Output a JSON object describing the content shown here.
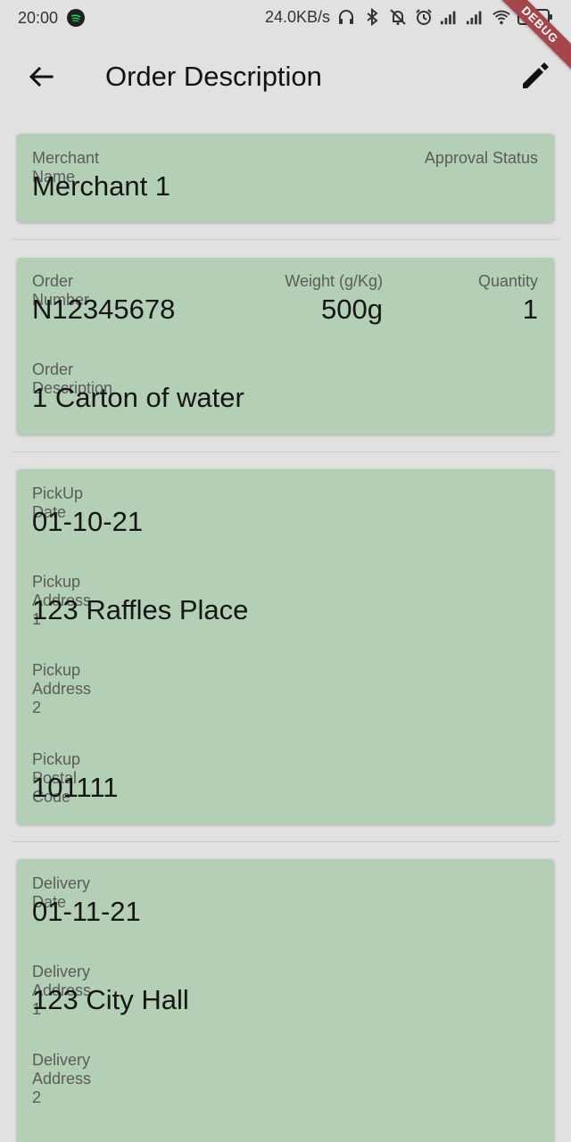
{
  "status_bar": {
    "time": "20:00",
    "network_speed": "24.0KB/s",
    "battery": "61",
    "icons": [
      "spotify-icon",
      "headphones-icon",
      "bluetooth-icon",
      "alarm-off-icon",
      "alarm-icon",
      "signal-icon",
      "signal-icon",
      "wifi-icon",
      "battery-icon"
    ]
  },
  "debug_banner": "DEBUG",
  "app_bar": {
    "title": "Order Description",
    "back_icon": "arrow-back-icon",
    "edit_icon": "edit-pencil-icon"
  },
  "merchant_card": {
    "merchant_label": "Merchant Name",
    "merchant_value": "Merchant 1",
    "approval_label": "Approval Status",
    "approval_value": ""
  },
  "order_card": {
    "order_number_label": "Order Number",
    "order_number_value": "N12345678",
    "weight_label": "Weight (g/Kg)",
    "weight_value": "500g",
    "quantity_label": "Quantity",
    "quantity_value": "1",
    "description_label": "Order Description",
    "description_value": "1 Carton of water"
  },
  "pickup_card": {
    "date_label": "PickUp Date",
    "date_value": "01-10-21",
    "address1_label": "Pickup Address 1",
    "address1_value": "123 Raffles Place",
    "address2_label": "Pickup Address 2",
    "address2_value": "",
    "postal_label": "Pickup Postal Code",
    "postal_value": "101111"
  },
  "delivery_card": {
    "date_label": "Delivery Date",
    "date_value": "01-11-21",
    "address1_label": "Delivery Address 1",
    "address1_value": "123 City Hall",
    "address2_label": "Delivery Address 2",
    "address2_value": ""
  },
  "colors": {
    "background": "#e1e1e1",
    "card": "#b3cfb5",
    "debug_ribbon": "#a5474a"
  }
}
